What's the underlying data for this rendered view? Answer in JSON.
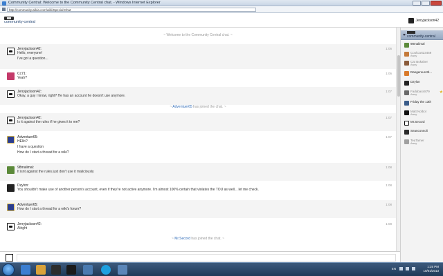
{
  "window": {
    "title": "Community Central: Welcome to the Community Central chat. - Windows Internet Explorer",
    "url": "http://community.wikia.com/wiki/Special:Chat"
  },
  "header": {
    "wiki_name": "community-central",
    "current_user": "Jerryjackson42"
  },
  "chat": {
    "welcome": "~ Welcome to the Community Central chat. ~",
    "joined_suffix": "has joined the chat.",
    "joins": [
      {
        "name": "Adventuer65"
      },
      {
        "name": "Mr.Secord"
      }
    ],
    "messages": [
      {
        "user": "Jerryjackson42:",
        "lines": [
          "Hello, everyone!",
          "I've got a question..."
        ],
        "time": "1:06"
      },
      {
        "user": "Cc71:",
        "lines": [
          "Yeah?"
        ],
        "time": "1:06"
      },
      {
        "user": "Jerryjackson42:",
        "lines": [
          "Okay, a guy I know, right? He has an account he doesn't use anymore."
        ],
        "time": "1:07"
      },
      {
        "user": "Jerryjackson42:",
        "lines": [
          "Is it against the rules if he gives it to me?"
        ],
        "time": "1:07"
      },
      {
        "user": "Adventuer65:",
        "lines": [
          "HEllo?",
          "I have a question",
          "How do I start a thread for a wiki?"
        ],
        "time": "1:07"
      },
      {
        "user": "98malimal:",
        "lines": [
          "It isnt against the rules just don't use it maliciously"
        ],
        "time": "1:08"
      },
      {
        "user": "Dzylon:",
        "lines": [
          "You shouldn't make use of another person's account, even if they're not active anymore. I'm almost 100% certain that violates the TOU as well... let me check."
        ],
        "time": "1:08"
      },
      {
        "user": "Adventuer65:",
        "lines": [
          "How do I start a thread for a wiki's forum?"
        ],
        "time": "1:08"
      },
      {
        "user": "Jerryjackson42:",
        "lines": [
          "Alright"
        ],
        "time": "1:08"
      }
    ]
  },
  "sidebar": {
    "title": "community-central",
    "users": [
      {
        "name": "98malimal",
        "status": ""
      },
      {
        "name": "CoolCart23459",
        "status": "Away"
      },
      {
        "name": "Cat Bokaher",
        "status": "Away"
      },
      {
        "name": "Dangerous Bl...",
        "status": ""
      },
      {
        "name": "Dzylon",
        "status": ""
      },
      {
        "name": "Fadaba44879",
        "status": "Away"
      },
      {
        "name": "Friday the 13th",
        "status": ""
      },
      {
        "name": "Matt Nolbot",
        "status": "Away"
      },
      {
        "name": "Mr.Secord",
        "status": ""
      },
      {
        "name": "Seanconnoli",
        "status": ""
      },
      {
        "name": "TeaTamer",
        "status": "Away"
      }
    ]
  },
  "taskbar": {
    "language": "EN",
    "time": "1:25 PM",
    "date": "10/01/2013"
  }
}
